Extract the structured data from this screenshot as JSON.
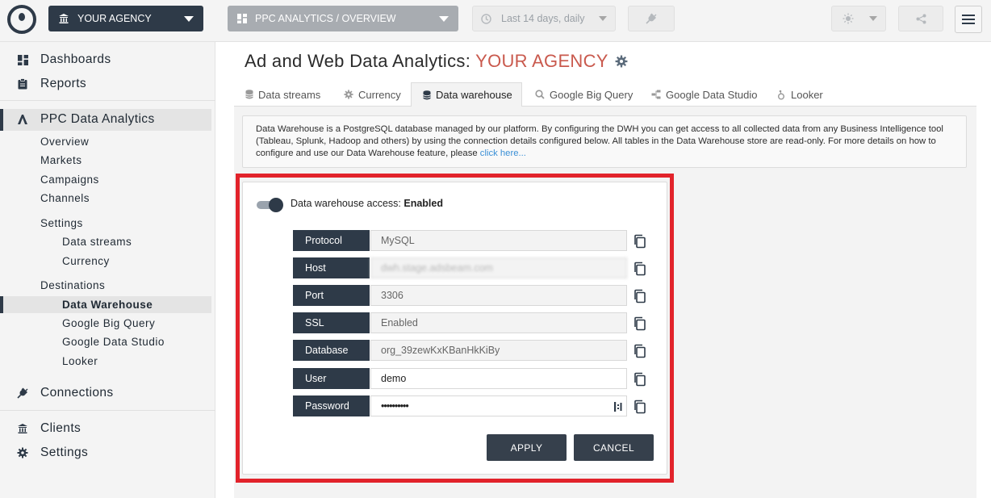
{
  "topbar": {
    "agency_label": "YOUR AGENCY",
    "view_label": "PPC ANALYTICS / OVERVIEW",
    "date_label": "Last 14 days, daily"
  },
  "sidebar": {
    "dashboards": "Dashboards",
    "reports": "Reports",
    "ppc": "PPC Data Analytics",
    "overview": "Overview",
    "markets": "Markets",
    "campaigns": "Campaigns",
    "channels": "Channels",
    "settings_group": "Settings",
    "data_streams": "Data streams",
    "currency": "Currency",
    "destinations_group": "Destinations",
    "data_warehouse": "Data Warehouse",
    "big_query": "Google Big Query",
    "data_studio": "Google Data Studio",
    "looker": "Looker",
    "connections": "Connections",
    "clients": "Clients",
    "settings": "Settings"
  },
  "page": {
    "title": "Ad and Web Data Analytics:",
    "agency": "YOUR AGENCY"
  },
  "tabs": [
    {
      "label": "Data streams"
    },
    {
      "label": "Currency"
    },
    {
      "label": "Data warehouse"
    },
    {
      "label": "Google Big Query"
    },
    {
      "label": "Google Data Studio"
    },
    {
      "label": "Looker"
    }
  ],
  "info": {
    "text": "Data Warehouse is a PostgreSQL database managed by our platform. By configuring the DWH you can get access to all collected data from any Business Intelligence tool (Tableau, Splunk, Hadoop and others) by using the connection details configured below. All tables in the Data Warehouse store are read-only. For more details on how to configure and use our Data Warehouse feature, please ",
    "link": "click here..."
  },
  "dwh": {
    "access_label": "Data warehouse access:",
    "access_state": "Enabled",
    "fields": [
      {
        "label": "Protocol",
        "value": "MySQL"
      },
      {
        "label": "Host",
        "value": "dwh.stage.adsbeam.com"
      },
      {
        "label": "Port",
        "value": "3306"
      },
      {
        "label": "SSL",
        "value": "Enabled"
      },
      {
        "label": "Database",
        "value": "org_39zewKxKBanHkKiBy"
      },
      {
        "label": "User",
        "value": "demo"
      },
      {
        "label": "Password",
        "value": "••••••••••"
      }
    ],
    "apply_label": "APPLY",
    "cancel_label": "CANCEL"
  },
  "colors": {
    "navy": "#2e3a48",
    "accent_red": "#c9594d",
    "frame_red": "#e2232b",
    "link_blue": "#3a8fd6"
  }
}
